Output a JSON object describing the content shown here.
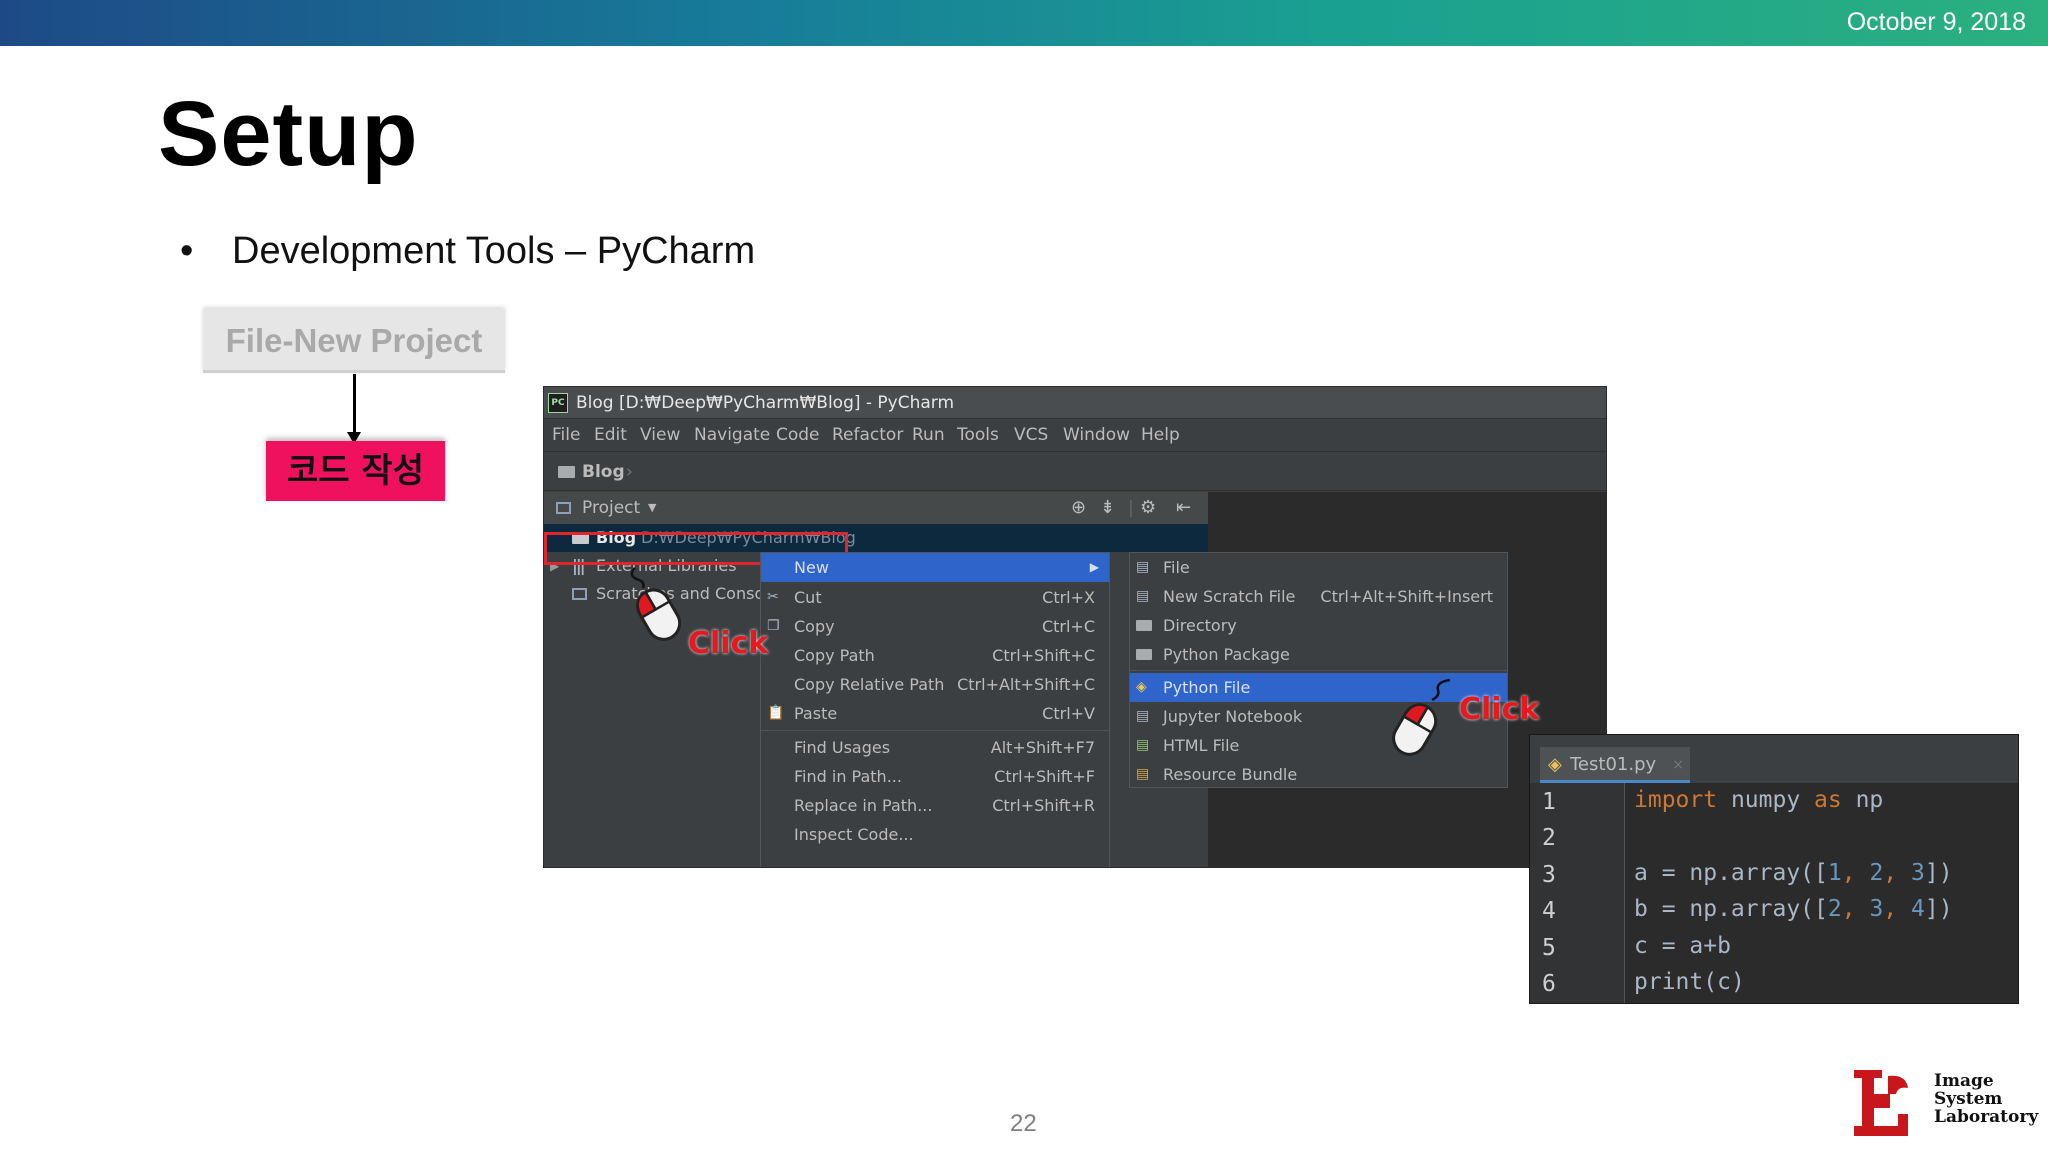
{
  "banner": {
    "date": "October 9, 2018"
  },
  "slide": {
    "title": "Setup",
    "bullet": "Development Tools – PyCharm",
    "page_number": "22"
  },
  "flow": {
    "step1": "File-New Project",
    "step2": "코드 작성"
  },
  "ide": {
    "logo_text": "PC",
    "title": "Blog [D:₩Deep₩PyCharm₩Blog] - PyCharm",
    "menu": [
      "File",
      "Edit",
      "View",
      "Navigate",
      "Code",
      "Refactor",
      "Run",
      "Tools",
      "VCS",
      "Window",
      "Help"
    ],
    "breadcrumb": "Blog",
    "breadcrumb_sep": "›",
    "project_panel_label": "Project",
    "toolbar_icons": [
      "target-icon",
      "collapse-icon",
      "gear-icon",
      "hide-icon"
    ],
    "tree": [
      {
        "label": "Blog",
        "path": "D:₩Deep₩PyCharm₩Blog"
      },
      {
        "label": "External Libraries"
      },
      {
        "label": "Scratches and Consoles"
      }
    ],
    "context_menu": [
      {
        "label": "New",
        "shortcut": "",
        "icon": ""
      },
      {
        "label": "Cut",
        "shortcut": "Ctrl+X",
        "icon": "cut-icon"
      },
      {
        "label": "Copy",
        "shortcut": "Ctrl+C",
        "icon": "copy-icon"
      },
      {
        "label": "Copy Path",
        "shortcut": "Ctrl+Shift+C",
        "icon": ""
      },
      {
        "label": "Copy Relative Path",
        "shortcut": "Ctrl+Alt+Shift+C",
        "icon": ""
      },
      {
        "label": "Paste",
        "shortcut": "Ctrl+V",
        "icon": "paste-icon"
      },
      {
        "label": "Find Usages",
        "shortcut": "Alt+Shift+F7",
        "icon": ""
      },
      {
        "label": "Find in Path...",
        "shortcut": "Ctrl+Shift+F",
        "icon": ""
      },
      {
        "label": "Replace in Path...",
        "shortcut": "Ctrl+Shift+R",
        "icon": ""
      },
      {
        "label": "Inspect Code...",
        "shortcut": "",
        "icon": ""
      }
    ],
    "submenu": [
      {
        "label": "File",
        "shortcut": ""
      },
      {
        "label": "New Scratch File",
        "shortcut": "Ctrl+Alt+Shift+Insert"
      },
      {
        "label": "Directory",
        "shortcut": ""
      },
      {
        "label": "Python Package",
        "shortcut": ""
      },
      {
        "label": "Python File",
        "shortcut": ""
      },
      {
        "label": "Jupyter Notebook",
        "shortcut": ""
      },
      {
        "label": "HTML File",
        "shortcut": ""
      },
      {
        "label": "Resource Bundle",
        "shortcut": ""
      }
    ]
  },
  "annotations": {
    "click1": "Click",
    "click2": "Click"
  },
  "editor": {
    "tab": "Test01.py",
    "tab_close": "×",
    "line_numbers": [
      "1",
      "2",
      "3",
      "4",
      "5",
      "6"
    ],
    "lines": [
      [
        {
          "t": "import",
          "c": "kw"
        },
        {
          "t": " numpy ",
          "c": ""
        },
        {
          "t": "as",
          "c": "kw"
        },
        {
          "t": " np",
          "c": ""
        }
      ],
      [],
      [
        {
          "t": "a = np.array([",
          "c": ""
        },
        {
          "t": "1",
          "c": "num"
        },
        {
          "t": ", ",
          "c": "kw"
        },
        {
          "t": "2",
          "c": "num"
        },
        {
          "t": ", ",
          "c": "kw"
        },
        {
          "t": "3",
          "c": "num"
        },
        {
          "t": "])",
          "c": ""
        }
      ],
      [
        {
          "t": "b = np.array([",
          "c": ""
        },
        {
          "t": "2",
          "c": "num"
        },
        {
          "t": ", ",
          "c": "kw"
        },
        {
          "t": "3",
          "c": "num"
        },
        {
          "t": ", ",
          "c": "kw"
        },
        {
          "t": "4",
          "c": "num"
        },
        {
          "t": "])",
          "c": ""
        }
      ],
      [
        {
          "t": "c = a+b",
          "c": ""
        }
      ],
      [
        {
          "t": "print",
          "c": ""
        },
        {
          "t": "(c)",
          "c": ""
        }
      ]
    ]
  },
  "logo": {
    "name_line1": "Image",
    "name_line2": "System",
    "name_line3": "Laboratory"
  }
}
